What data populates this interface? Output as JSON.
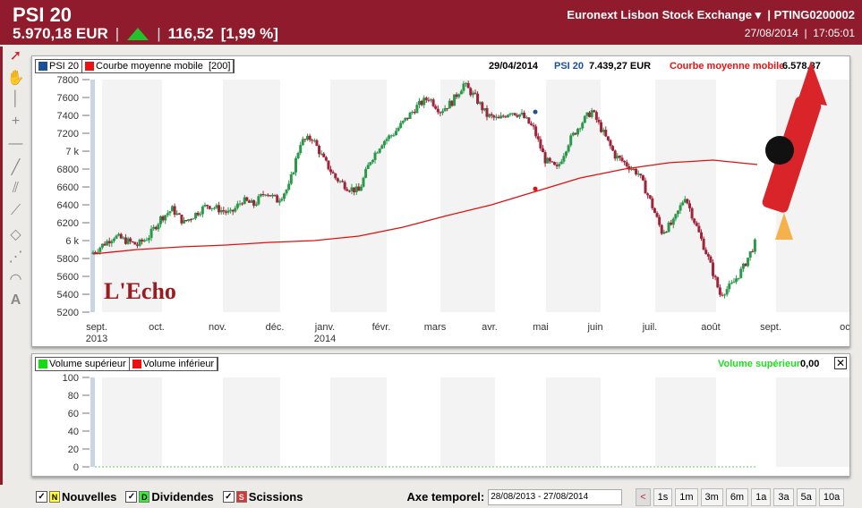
{
  "header": {
    "title": "PSI 20",
    "price": "5.970,18 EUR",
    "change": "116,52",
    "change_pct": "[1,99 %]",
    "exchange": "Euronext Lisbon Stock Exchange",
    "isin": "PTING0200002",
    "date": "27/08/2014",
    "time": "17:05:01",
    "up_color": "#22c32a"
  },
  "tools": [
    "cursor-icon",
    "hand-icon",
    "vertical-line-icon",
    "crosshair-icon",
    "horizontal-line-icon",
    "trend-line-icon",
    "parallel-lines-icon",
    "ray-icon",
    "rectangle-icon",
    "fan-icon",
    "arc-icon",
    "text-icon"
  ],
  "legend": {
    "series": "PSI 20",
    "ma": "Courbe moyenne mobile  [200]"
  },
  "info": {
    "date": "29/04/2014",
    "series": "PSI 20",
    "value": "7.439,27 EUR",
    "ma_label": "Courbe moyenne mobile",
    "ma_value": "6.578,87"
  },
  "logo": "L'Echo",
  "chart_data": {
    "type": "candlestick",
    "title": "PSI 20",
    "ylim": [
      5200,
      7800
    ],
    "yticks": [
      "7800",
      "7600",
      "7400",
      "7200",
      "7 k",
      "6800",
      "6600",
      "6400",
      "6200",
      "6 k",
      "5800",
      "5600",
      "5400",
      "5200"
    ],
    "months": [
      {
        "l": "sept.",
        "y": "2013"
      },
      {
        "l": "oct."
      },
      {
        "l": "nov."
      },
      {
        "l": "déc."
      },
      {
        "l": "janv.",
        "y": "2014"
      },
      {
        "l": "févr."
      },
      {
        "l": "mars"
      },
      {
        "l": "avr."
      },
      {
        "l": "mai"
      },
      {
        "l": "juin"
      },
      {
        "l": "juil."
      },
      {
        "l": "août"
      },
      {
        "l": "sept."
      },
      {
        "l": "oct."
      }
    ],
    "weekly_close": [
      5850,
      5950,
      6050,
      6000,
      5950,
      6050,
      6250,
      6350,
      6200,
      6300,
      6400,
      6350,
      6300,
      6450,
      6400,
      6550,
      6450,
      6600,
      7100,
      7150,
      6900,
      6700,
      6600,
      6550,
      6900,
      7100,
      7200,
      7350,
      7500,
      7600,
      7450,
      7550,
      7750,
      7600,
      7400,
      7350,
      7450,
      7400,
      7250,
      6900,
      6800,
      7100,
      7300,
      7450,
      7200,
      6950,
      6850,
      6750,
      6450,
      6100,
      6200,
      6500,
      6150,
      5800,
      5400,
      5500,
      5700,
      5970
    ],
    "moving_average_200": [
      5850,
      5900,
      5930,
      5950,
      5980,
      6000,
      6050,
      6150,
      6280,
      6400,
      6550,
      6700,
      6800,
      6870,
      6900,
      6850
    ],
    "volume": {
      "ylim": [
        0,
        100
      ],
      "yticks": [
        "100",
        "80",
        "60",
        "40",
        "20",
        "0"
      ],
      "legend_up": "Volume supérieur",
      "legend_down": "Volume inférieur",
      "label": "Volume supérieur",
      "value": "0,00"
    }
  },
  "bottom": {
    "news": "Nouvelles",
    "news_tag": "N",
    "div": "Dividendes",
    "div_tag": "D",
    "split": "Scissions",
    "split_tag": "S",
    "axis_label": "Axe temporel:",
    "range": "28/08/2013 - 27/08/2014",
    "periods": [
      "<",
      "1s",
      "1m",
      "3m",
      "6m",
      "1a",
      "3a",
      "5a",
      "10a"
    ]
  }
}
